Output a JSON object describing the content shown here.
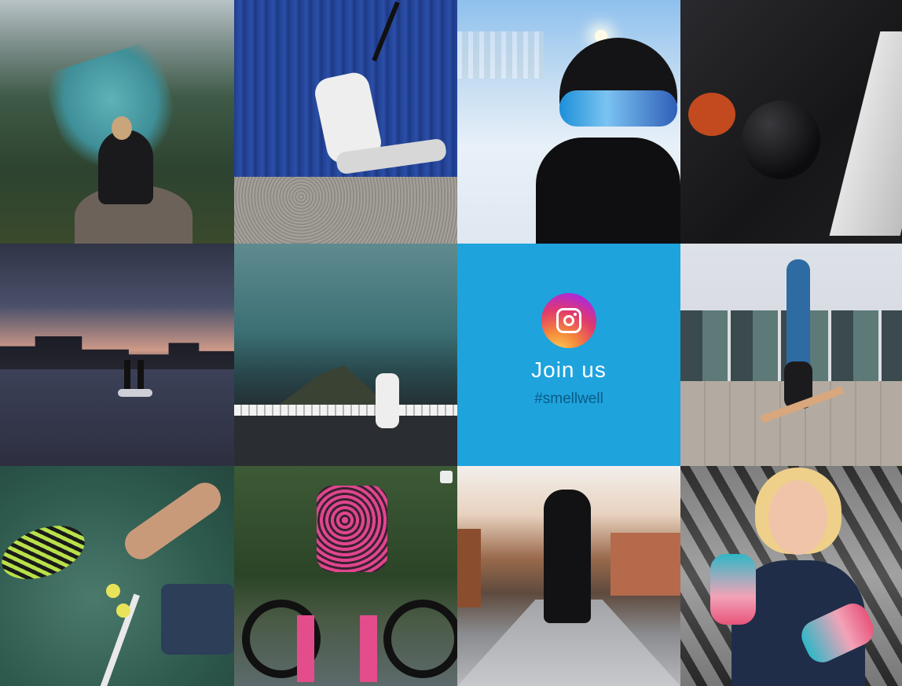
{
  "cta": {
    "icon": "instagram-icon",
    "title": "Join us",
    "hashtag": "#smellwell",
    "background": "#1ea3dd",
    "hashtag_color": "#0b5b86"
  },
  "tiles": [
    {
      "name": "photo-mountain-lake"
    },
    {
      "name": "photo-trx-workout"
    },
    {
      "name": "photo-snow-helmet"
    },
    {
      "name": "photo-medicine-ball"
    },
    {
      "name": "photo-paddleboard-dusk"
    },
    {
      "name": "photo-longboard-road"
    },
    {
      "name": "instagram-join-tile"
    },
    {
      "name": "photo-handstand"
    },
    {
      "name": "photo-padel-tennis"
    },
    {
      "name": "photo-road-cyclist"
    },
    {
      "name": "photo-runner-sunset"
    },
    {
      "name": "photo-woman-with-shoes"
    }
  ]
}
